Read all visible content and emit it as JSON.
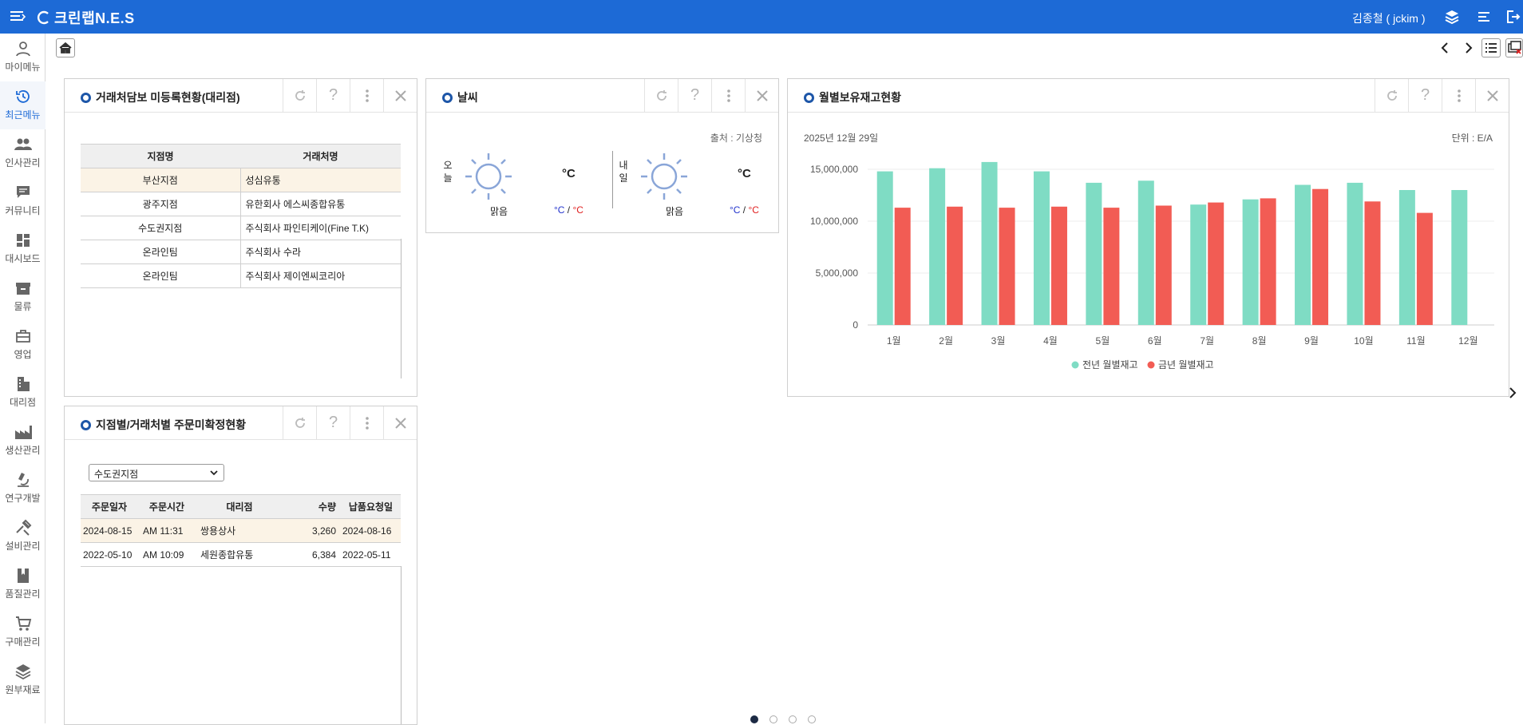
{
  "app": {
    "logo_text": "크린랩N.E.S",
    "user": "김종철 ( jckim )"
  },
  "sidebar": {
    "items": [
      {
        "label": "마이메뉴",
        "icon": "person-icon"
      },
      {
        "label": "최근메뉴",
        "icon": "history-icon",
        "active": true
      },
      {
        "label": "인사관리",
        "icon": "people-icon"
      },
      {
        "label": "커뮤니티",
        "icon": "chat-icon"
      },
      {
        "label": "대시보드",
        "icon": "dashboard-icon"
      },
      {
        "label": "물류",
        "icon": "box-icon"
      },
      {
        "label": "영업",
        "icon": "briefcase-icon"
      },
      {
        "label": "대리점",
        "icon": "building-icon"
      },
      {
        "label": "생산관리",
        "icon": "factory-icon"
      },
      {
        "label": "연구개발",
        "icon": "microscope-icon"
      },
      {
        "label": "설비관리",
        "icon": "tools-icon"
      },
      {
        "label": "품질관리",
        "icon": "book-icon"
      },
      {
        "label": "구매관리",
        "icon": "cart-icon"
      },
      {
        "label": "원부재료",
        "icon": "layers-icon"
      }
    ]
  },
  "widgets": {
    "collateral": {
      "title": "거래처담보 미등록현황(대리점)",
      "headers": [
        "지점명",
        "거래처명"
      ],
      "rows": [
        [
          "부산지점",
          "성심유통"
        ],
        [
          "광주지점",
          "유한회사 에스씨종합유통"
        ],
        [
          "수도권지점",
          "주식회사 파인티케이(Fine T.K)"
        ],
        [
          "온라인팀",
          "주식회사 수라"
        ],
        [
          "온라인팀",
          "주식회사 제이엔씨코리아"
        ]
      ]
    },
    "weather": {
      "title": "날씨",
      "source": "출처 : 기상청",
      "today": {
        "label": "오늘",
        "label_chars": [
          "오",
          "늘"
        ],
        "temp": "°C",
        "cond": "맑음",
        "min": "°C",
        "sep": " / ",
        "max": "°C"
      },
      "tomorrow": {
        "label": "내일",
        "label_chars": [
          "내",
          "일"
        ],
        "temp": "°C",
        "cond": "맑음",
        "min": "°C",
        "sep": " / ",
        "max": "°C"
      }
    },
    "inventory": {
      "title": "월별보유재고현황",
      "date": "2025년 12월 29일",
      "unit": "단위 : E/A"
    },
    "orders": {
      "title": "지점별/거래처별 주문미확정현황",
      "select_value": "수도권지점",
      "headers": [
        "주문일자",
        "주문시간",
        "대리점",
        "수량",
        "납품요청일"
      ],
      "rows": [
        [
          "2024-08-15",
          "AM 11:31",
          "쌍용상사",
          "3,260",
          "2024-08-16"
        ],
        [
          "2022-05-10",
          "AM 10:09",
          "세원종합유통",
          "6,384",
          "2022-05-11"
        ]
      ]
    }
  },
  "chart_data": {
    "type": "bar",
    "categories": [
      "1월",
      "2월",
      "3월",
      "4월",
      "5월",
      "6월",
      "7월",
      "8월",
      "9월",
      "10월",
      "11월",
      "12월"
    ],
    "series": [
      {
        "name": "전년 월별재고",
        "color": "#7fdcc4",
        "values": [
          14800000,
          15100000,
          15700000,
          14800000,
          13700000,
          13900000,
          11600000,
          12100000,
          13500000,
          13700000,
          13000000,
          13000000
        ]
      },
      {
        "name": "금년 월별재고",
        "color": "#f25c54",
        "values": [
          11300000,
          11400000,
          11300000,
          11400000,
          11300000,
          11500000,
          11800000,
          12200000,
          13100000,
          11900000,
          10800000,
          null
        ]
      }
    ],
    "y_ticks": [
      "0",
      "5,000,000",
      "10,000,000",
      "15,000,000"
    ],
    "ylim": [
      0,
      16000000
    ],
    "legend": "bottom",
    "grid": true
  },
  "pager": {
    "pages": 4,
    "current": 0
  }
}
